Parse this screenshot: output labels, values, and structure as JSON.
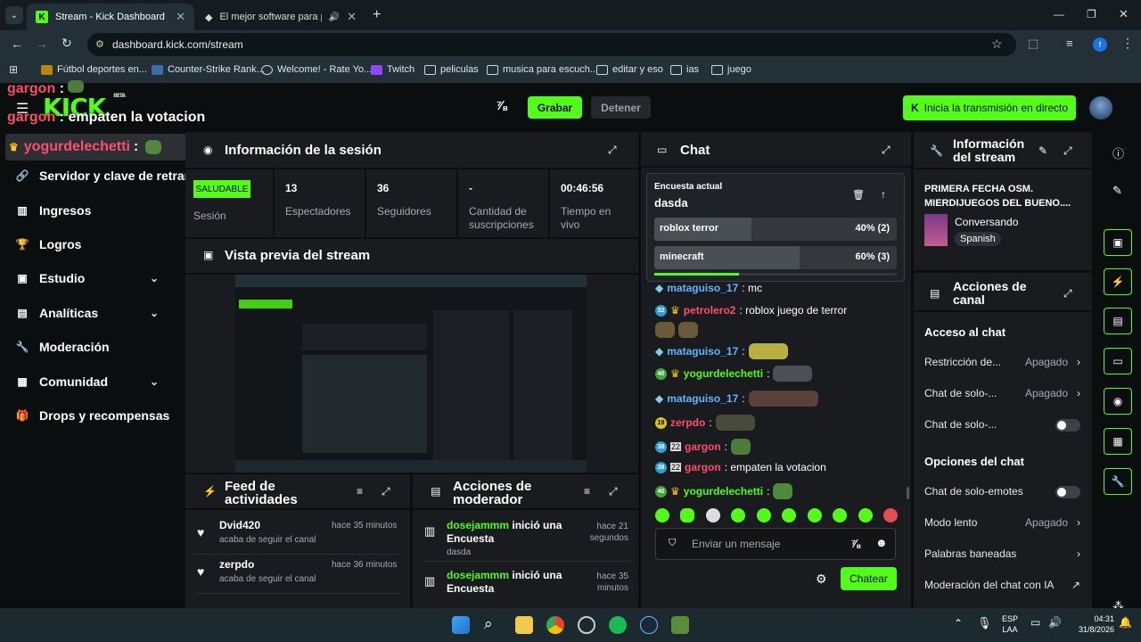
{
  "browser": {
    "tabs": [
      {
        "title": "Stream - Kick Dashboard",
        "active": true
      },
      {
        "title": "El mejor software para pote",
        "active": false
      }
    ],
    "url": "dashboard.kick.com/stream",
    "bookmarks": [
      "Fútbol deportes en...",
      "Counter-Strike Rank...",
      "Welcome! - Rate Yo...",
      "Twitch",
      "peliculas",
      "musica para escuch...",
      "editar y eso",
      "ias",
      "juego"
    ],
    "profile_initial": "f"
  },
  "overlay": {
    "line1_name": "gargon",
    "line2_name": "gargon",
    "line2_text": "empaten la votacion",
    "line3_name": "yogurdelechetti",
    "logo": "KICK",
    "logo_beta": "BETA"
  },
  "topnav": {
    "record_label": "Grabar",
    "stop_label": "Detener",
    "live_label": "Inicia la transmisión en directo"
  },
  "sidebar": {
    "items": [
      {
        "label": "Servidor y clave de retrans",
        "icon": "link-icon"
      },
      {
        "label": "Ingresos",
        "icon": "chart-icon"
      },
      {
        "label": "Logros",
        "icon": "trophy-icon"
      },
      {
        "label": "Estudio",
        "icon": "studio-icon",
        "expandable": true
      },
      {
        "label": "Analíticas",
        "icon": "analytics-icon",
        "expandable": true
      },
      {
        "label": "Moderación",
        "icon": "wrench-icon"
      },
      {
        "label": "Comunidad",
        "icon": "community-icon",
        "expandable": true
      },
      {
        "label": "Drops y recompensas",
        "icon": "gift-icon"
      }
    ]
  },
  "session": {
    "title": "Información de la sesión",
    "status": "SALUDABLE",
    "status_label": "Sesión",
    "stats": [
      {
        "value": "13",
        "label": "Espectadores"
      },
      {
        "value": "36",
        "label": "Seguidores"
      },
      {
        "value": "-",
        "label": "Cantidad de suscripciones"
      },
      {
        "value": "00:46:56",
        "label": "Tiempo en vivo"
      }
    ]
  },
  "preview": {
    "title": "Vista previa del stream"
  },
  "activity": {
    "title": "Feed de actividades",
    "items": [
      {
        "user": "Dvid420",
        "action": "acaba de seguir el canal",
        "time": "hace 35 minutos"
      },
      {
        "user": "zerpdo",
        "action": "acaba de seguir el canal",
        "time": "hace 36 minutos"
      }
    ]
  },
  "mod_actions": {
    "title": "Acciones de moderador",
    "items": [
      {
        "user": "dosejammm",
        "action": "inició una Encuesta",
        "detail": "dasda",
        "time": "hace 21 segundos"
      },
      {
        "user": "dosejammm",
        "action": "inició una Encuesta",
        "detail": "",
        "time": "hace 35 minutos"
      }
    ]
  },
  "chat": {
    "title": "Chat",
    "poll": {
      "header": "Encuesta actual",
      "question": "dasda",
      "options": [
        {
          "label": "roblox terror",
          "result": "40% (2)",
          "pct": 40
        },
        {
          "label": "minecraft",
          "result": "60% (3)",
          "pct": 60
        }
      ],
      "time_remaining_fraction": 0.35
    },
    "messages": [
      {
        "user": "mataguiso_17",
        "text": ": mc",
        "color": "#5fb6ff",
        "badge": ""
      },
      {
        "user": "petrolero2",
        "text": ": roblox juego de terror",
        "color": "#ff4d6d",
        "badge": "32"
      },
      {
        "user": "",
        "text": "",
        "color": "#fff",
        "badge": ""
      },
      {
        "user": "mataguiso_17",
        "text": ":",
        "color": "#5fb6ff",
        "badge": ""
      },
      {
        "user": "yogurdelechetti",
        "text": ":",
        "color": "#53fc18",
        "badge": "40"
      },
      {
        "user": "mataguiso_17",
        "text": ":",
        "color": "#5fb6ff",
        "badge": ""
      },
      {
        "user": "zerpdo",
        "text": ":",
        "color": "#ff4d6d",
        "badge": "19"
      },
      {
        "user": "gargon",
        "text": ":",
        "color": "#ff4d6d",
        "badge": "38"
      },
      {
        "user": "gargon",
        "text": ": empaten la votacion",
        "color": "#ff4d6d",
        "badge": "38"
      },
      {
        "user": "yogurdelechetti",
        "text": ":",
        "color": "#53fc18",
        "badge": "40"
      }
    ],
    "input_placeholder": "Enviar un mensaje",
    "send_label": "Chatear"
  },
  "stream_info": {
    "title": "Información del stream",
    "stream_title": "PRIMERA FECHA OSM. MIERDIJUEGOS DEL BUENO....",
    "category": "Conversando",
    "language": "Spanish"
  },
  "channel_actions": {
    "title": "Acciones de canal",
    "section1": "Acceso al chat",
    "rows1": [
      {
        "label": "Restricción de...",
        "value": "Apagado",
        "type": "chevron"
      },
      {
        "label": "Chat de solo-...",
        "value": "Apagado",
        "type": "chevron"
      },
      {
        "label": "Chat de solo-...",
        "value": "",
        "type": "toggle"
      }
    ],
    "section2": "Opciones del chat",
    "rows2": [
      {
        "label": "Chat de solo-emotes",
        "value": "",
        "type": "toggle"
      },
      {
        "label": "Modo lento",
        "value": "Apagado",
        "type": "chevron"
      },
      {
        "label": "Palabras baneadas",
        "value": "",
        "type": "chevron"
      },
      {
        "label": "Moderación del chat con IA",
        "value": "",
        "type": "external"
      }
    ]
  },
  "taskbar": {
    "lang": "ESP",
    "lang2": "LAA",
    "time": "04:31",
    "date": "31/8/2026"
  },
  "colors": {
    "accent": "#53fc18",
    "panel": "#191b1f",
    "bg": "#0b0e0f"
  }
}
